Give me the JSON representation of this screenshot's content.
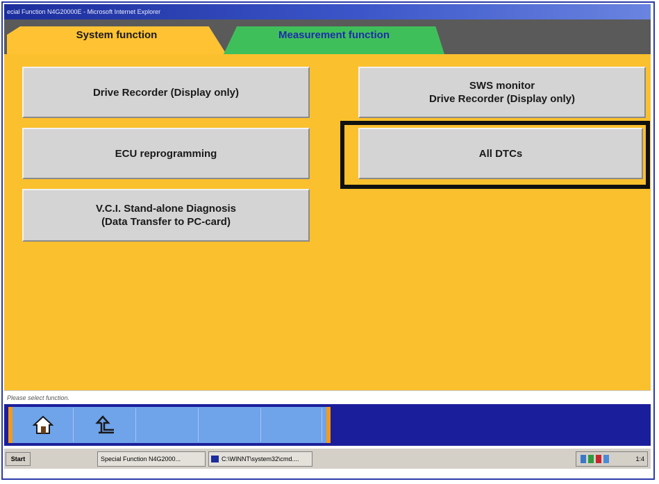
{
  "window": {
    "title": "ecial Function N4G20000E - Microsoft Internet Explorer"
  },
  "tabs": [
    {
      "label": "System function",
      "active": true
    },
    {
      "label": "Measurement function",
      "active": false
    }
  ],
  "functions": {
    "drive_recorder": "Drive Recorder (Display only)",
    "sws_monitor_line1": "SWS monitor",
    "sws_monitor_line2": "Drive Recorder (Display only)",
    "ecu_reprogramming": "ECU reprogramming",
    "all_dtcs": "All DTCs",
    "vci_line1": "V.C.I. Stand-alone Diagnosis",
    "vci_line2": "(Data Transfer to PC-card)"
  },
  "status": {
    "message": "Please select function."
  },
  "toolbar": {
    "buttons": [
      {
        "icon": "home-icon"
      },
      {
        "icon": "back-arrow-icon"
      }
    ]
  },
  "taskbar": {
    "start_label": "Start",
    "items": [
      "Special Function N4G2000...",
      "C:\\WINNT\\system32\\cmd...."
    ],
    "clock": "1:4"
  },
  "colors": {
    "content_bg": "#fbc02d",
    "tab_system": "#ffc233",
    "tab_measure": "#3fbf5a",
    "toolbar_bg": "#1b1e9a",
    "highlight_border": "#111111"
  }
}
